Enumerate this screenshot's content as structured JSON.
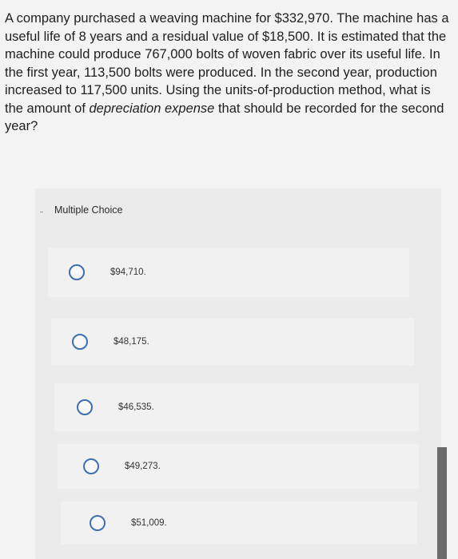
{
  "question": {
    "part1": "A company purchased a weaving machine for $332,970. The machine has a useful life of 8 years and a residual value of $18,500. It is estimated that the machine could produce 767,000 bolts of woven fabric over its useful life. In the first year, 113,500 bolts were produced. In the second year, production increased to 117,500 units. Using the units-of-production method, what is the amount of ",
    "emphasis1": "depreciation expense",
    "part2": " that should be recorded for the second year?"
  },
  "multiple_choice": {
    "label": "Multiple Choice",
    "options": [
      {
        "label": "$94,710."
      },
      {
        "label": "$48,175."
      },
      {
        "label": "$46,535."
      },
      {
        "label": "$49,273."
      },
      {
        "label": "$51,009."
      }
    ]
  }
}
